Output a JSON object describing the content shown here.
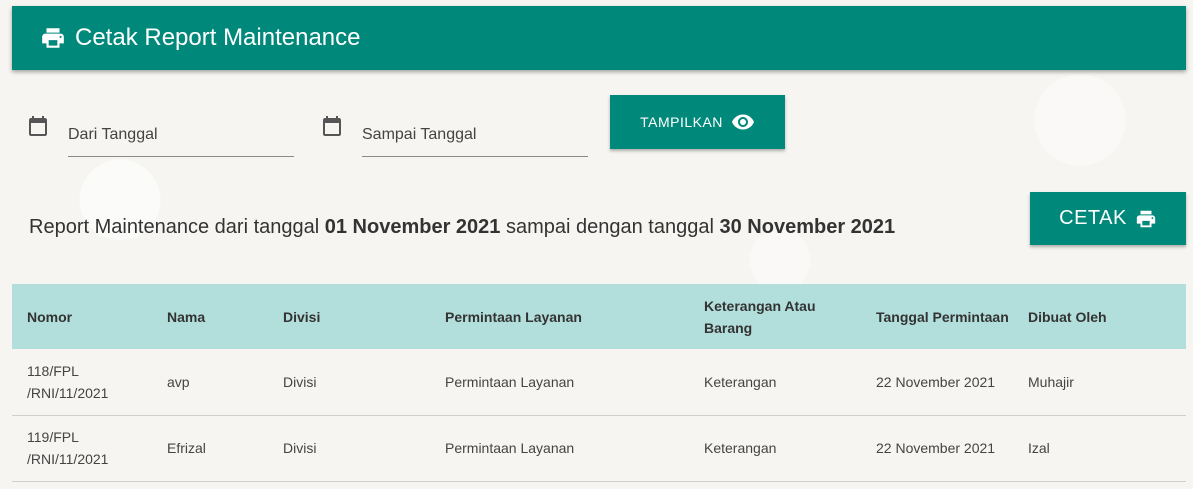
{
  "header": {
    "title": "Cetak Report Maintenance",
    "icon": "printer-icon"
  },
  "filters": {
    "from_label": "Dari Tanggal",
    "to_label": "Sampai Tanggal",
    "show_button": "TAMPILKAN"
  },
  "summary": {
    "prefix": "Report Maintenance dari tanggal ",
    "from_date": "01 November 2021",
    "middle": " sampai dengan tanggal ",
    "to_date": "30 November 2021"
  },
  "print_button": "CETAK",
  "colors": {
    "primary": "#00897b",
    "table_header": "#b2dfdb"
  },
  "table": {
    "headers": [
      "Nomor",
      "Nama",
      "Divisi",
      "Permintaan Layanan",
      "Keterangan Atau Barang",
      "Tanggal Permintaan",
      "Dibuat Oleh"
    ],
    "rows": [
      [
        "118/FPL /RNI/11/2021",
        "avp",
        "Divisi",
        "Permintaan Layanan",
        "Keterangan",
        "22 November 2021",
        "Muhajir"
      ],
      [
        "119/FPL /RNI/11/2021",
        "Efrizal",
        "Divisi",
        "Permintaan Layanan",
        "Keterangan",
        "22 November 2021",
        "Izal"
      ]
    ]
  }
}
